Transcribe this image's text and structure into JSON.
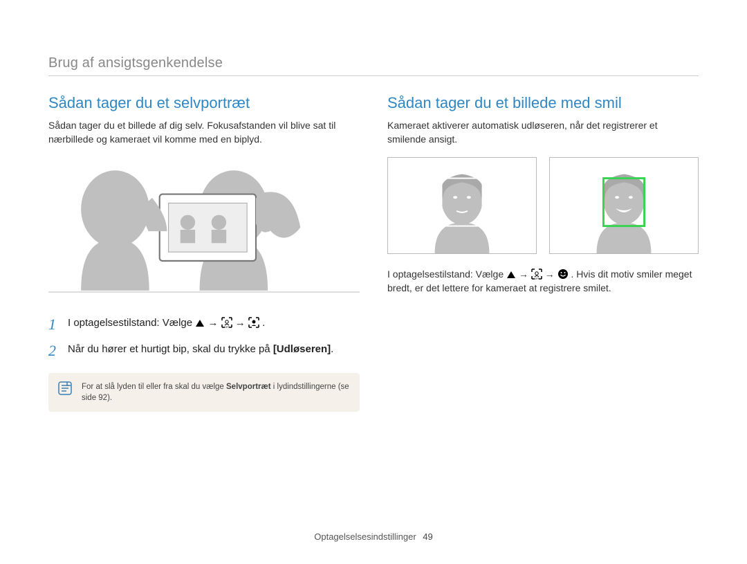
{
  "section_title": "Brug af ansigtsgenkendelse",
  "left": {
    "heading": "Sådan tager du et selvportræt",
    "intro": "Sådan tager du et billede af dig selv. Fokusafstanden vil blive sat til nærbillede og kameraet vil komme med en biplyd.",
    "step1_num": "1",
    "step1_prefix": "I optagelsestilstand: Vælge ",
    "step1_suffix": ".",
    "step2_num": "2",
    "step2_text": "Når du hører et hurtigt bip, skal du trykke på ",
    "step2_bold": "[Udløseren]",
    "step2_suffix": ".",
    "note_prefix": "For at slå lyden til eller fra skal du vælge ",
    "note_bold": "Selvportræt",
    "note_suffix": " i lydindstillingerne (se side 92).",
    "icons": {
      "up": "up-triangle-icon",
      "facedetect_off": "face-detect-off-icon",
      "selfportrait": "self-portrait-icon"
    }
  },
  "right": {
    "heading": "Sådan tager du et billede med smil",
    "intro": "Kameraet aktiverer automatisk udløseren, når det registrerer et smilende ansigt.",
    "para_prefix": "I optagelsestilstand: Vælge ",
    "para_mid": ". Hvis dit motiv smiler meget bredt, er det lettere for kameraet at registrere smilet.",
    "icons": {
      "up": "up-triangle-icon",
      "facedetect_off": "face-detect-off-icon",
      "smile": "smile-shot-icon"
    }
  },
  "arrow": " → ",
  "footer": {
    "label": "Optagelselsesindstillinger",
    "pagenum": "49"
  }
}
